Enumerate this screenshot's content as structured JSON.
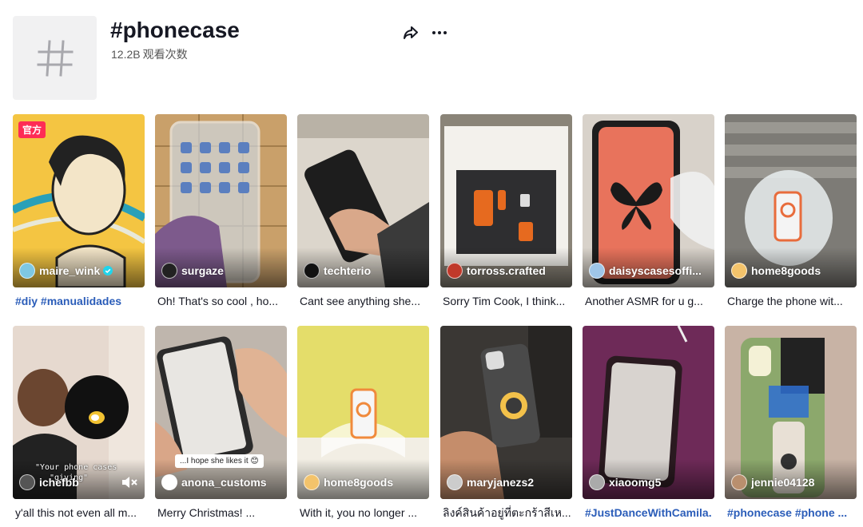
{
  "tag": {
    "title": "#phonecase",
    "views_count": "12.2B",
    "views_label": "观看次数"
  },
  "colors": {
    "link": "#2b5db9",
    "official_badge": "#fe2c55",
    "avatar_bg": "#f1f1f2"
  },
  "videos": [
    {
      "author": "maire_wink",
      "verified": true,
      "badge": "官方",
      "caption_hashtags": [
        "#diy",
        "#manualidades"
      ]
    },
    {
      "author": "surgaze",
      "caption": "Oh! That's so cool , ho..."
    },
    {
      "author": "techterio",
      "caption": "Cant see anything she..."
    },
    {
      "author": "torross.crafted",
      "caption": "Sorry Tim Cook, I think..."
    },
    {
      "author": "daisyscasesoffi...",
      "caption": "Another ASMR for u g..."
    },
    {
      "author": "home8goods",
      "caption": "Charge the phone wit..."
    },
    {
      "author": "ichefbb",
      "caption": "y'all this not even all m...",
      "overlay_text": [
        "\"Your phone cases",
        "\"giving\""
      ]
    },
    {
      "author": "anona_customs",
      "caption": "Merry Christmas! ...",
      "sticker": "...I hope she likes it 😊"
    },
    {
      "author": "home8goods",
      "caption": "With it, you no longer ..."
    },
    {
      "author": "maryjanezs2",
      "caption": "ลิงค์สินค้าอยู่ที่ตะกร้าสีเห..."
    },
    {
      "author": "xiaoomg5",
      "caption": "#JustDanceWithCamila.",
      "caption_is_hashtag": true
    },
    {
      "author": "jennie04128",
      "caption_hashtags": [
        "#phonecase",
        "#phone ..."
      ]
    }
  ]
}
